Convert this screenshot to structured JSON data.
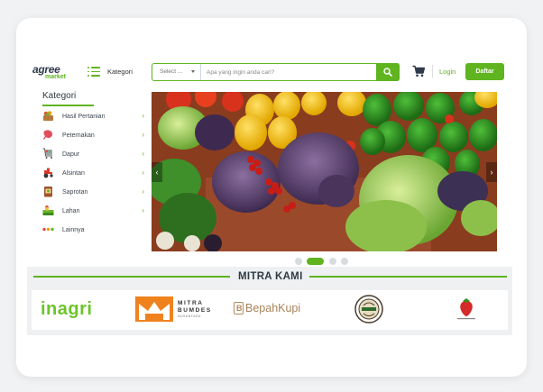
{
  "header": {
    "logo_line1": "agree",
    "logo_line2": "market",
    "kategori_label": "Kategori",
    "search": {
      "select_value": "Select ...",
      "placeholder": "Apa yang ingin anda cari?"
    },
    "login_label": "Login",
    "register_label": "Daftar"
  },
  "sidebar": {
    "title": "Kategori",
    "items": [
      {
        "label": "Hasil Pertanian",
        "icon": "harvest-basket-icon"
      },
      {
        "label": "Peternakan",
        "icon": "meat-icon"
      },
      {
        "label": "Dapur",
        "icon": "kitchen-cart-icon"
      },
      {
        "label": "Alsintan",
        "icon": "tractor-icon"
      },
      {
        "label": "Saprotan",
        "icon": "fertilizer-bag-icon"
      },
      {
        "label": "Lahan",
        "icon": "land-icon"
      },
      {
        "label": "Lainnya",
        "icon": "more-dots-icon"
      }
    ]
  },
  "banner": {
    "slide_count": 4,
    "active_slide": 2
  },
  "mitra": {
    "title": "MITRA KAMI",
    "partners": {
      "inagri": "inagri",
      "bumdes_line1": "MITRA",
      "bumdes_line2": "BUMDES",
      "bumdes_line3": "NUSANTARA",
      "bepah": "BepahKupi"
    }
  },
  "colors": {
    "accent": "#5fb41f",
    "text_dark": "#2f3a44",
    "band_bg": "#eef0f2"
  }
}
